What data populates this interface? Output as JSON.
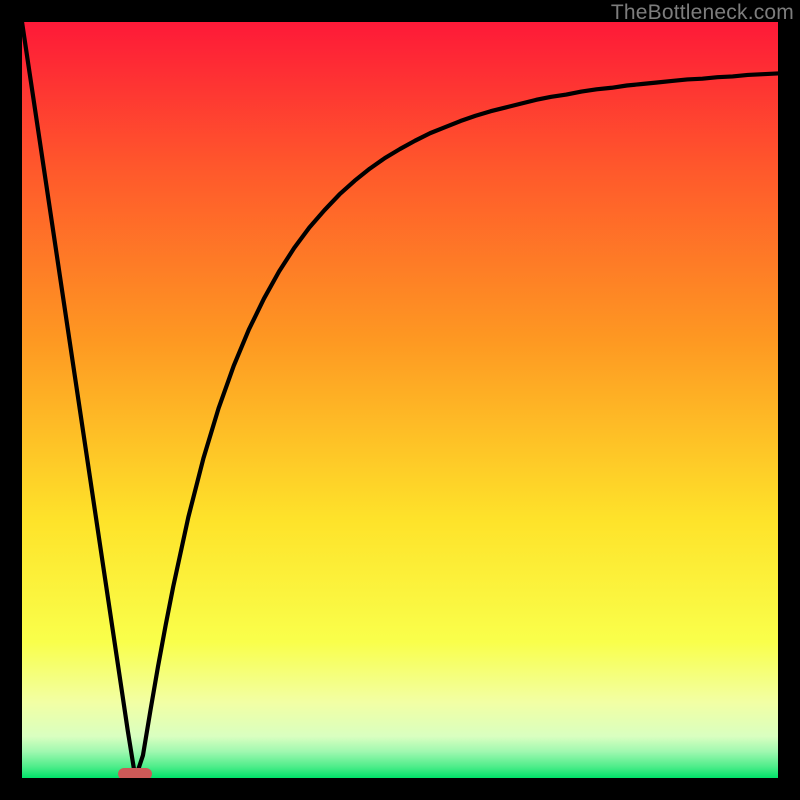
{
  "watermark": "TheBottleneck.com",
  "colors": {
    "top": "#fe1938",
    "mid1": "#fe9322",
    "mid2": "#fefb32",
    "mid3": "#f5ff7b",
    "bottom_band": "#b0ffb0",
    "bottom": "#00e56a",
    "curve": "#000000",
    "marker": "#cc5a58",
    "frame": "#000000"
  },
  "chart_data": {
    "type": "line",
    "title": "",
    "xlabel": "",
    "ylabel": "",
    "xlim": [
      0,
      100
    ],
    "ylim": [
      0,
      100
    ],
    "x": [
      0,
      1,
      2,
      3,
      4,
      5,
      6,
      7,
      8,
      9,
      10,
      11,
      12,
      13,
      14,
      15,
      16,
      17,
      18,
      19,
      20,
      22,
      24,
      26,
      28,
      30,
      32,
      34,
      36,
      38,
      40,
      42,
      44,
      46,
      48,
      50,
      52,
      54,
      56,
      58,
      60,
      62,
      64,
      66,
      68,
      70,
      72,
      74,
      76,
      78,
      80,
      82,
      84,
      86,
      88,
      90,
      92,
      94,
      96,
      98,
      100
    ],
    "values": [
      100,
      93.3,
      86.6,
      79.9,
      73.2,
      66.5,
      59.8,
      53.1,
      46.4,
      39.7,
      33.0,
      26.3,
      19.6,
      12.9,
      6.2,
      0.0,
      3.0,
      9.0,
      14.8,
      20.2,
      25.3,
      34.5,
      42.3,
      48.9,
      54.5,
      59.3,
      63.4,
      67.0,
      70.1,
      72.8,
      75.1,
      77.2,
      79.0,
      80.6,
      82.0,
      83.2,
      84.3,
      85.3,
      86.1,
      86.9,
      87.6,
      88.2,
      88.7,
      89.2,
      89.7,
      90.1,
      90.4,
      90.8,
      91.1,
      91.3,
      91.6,
      91.8,
      92.0,
      92.2,
      92.4,
      92.5,
      92.7,
      92.8,
      93.0,
      93.1,
      93.2
    ],
    "minimum": {
      "x": 15,
      "y": 0
    }
  }
}
